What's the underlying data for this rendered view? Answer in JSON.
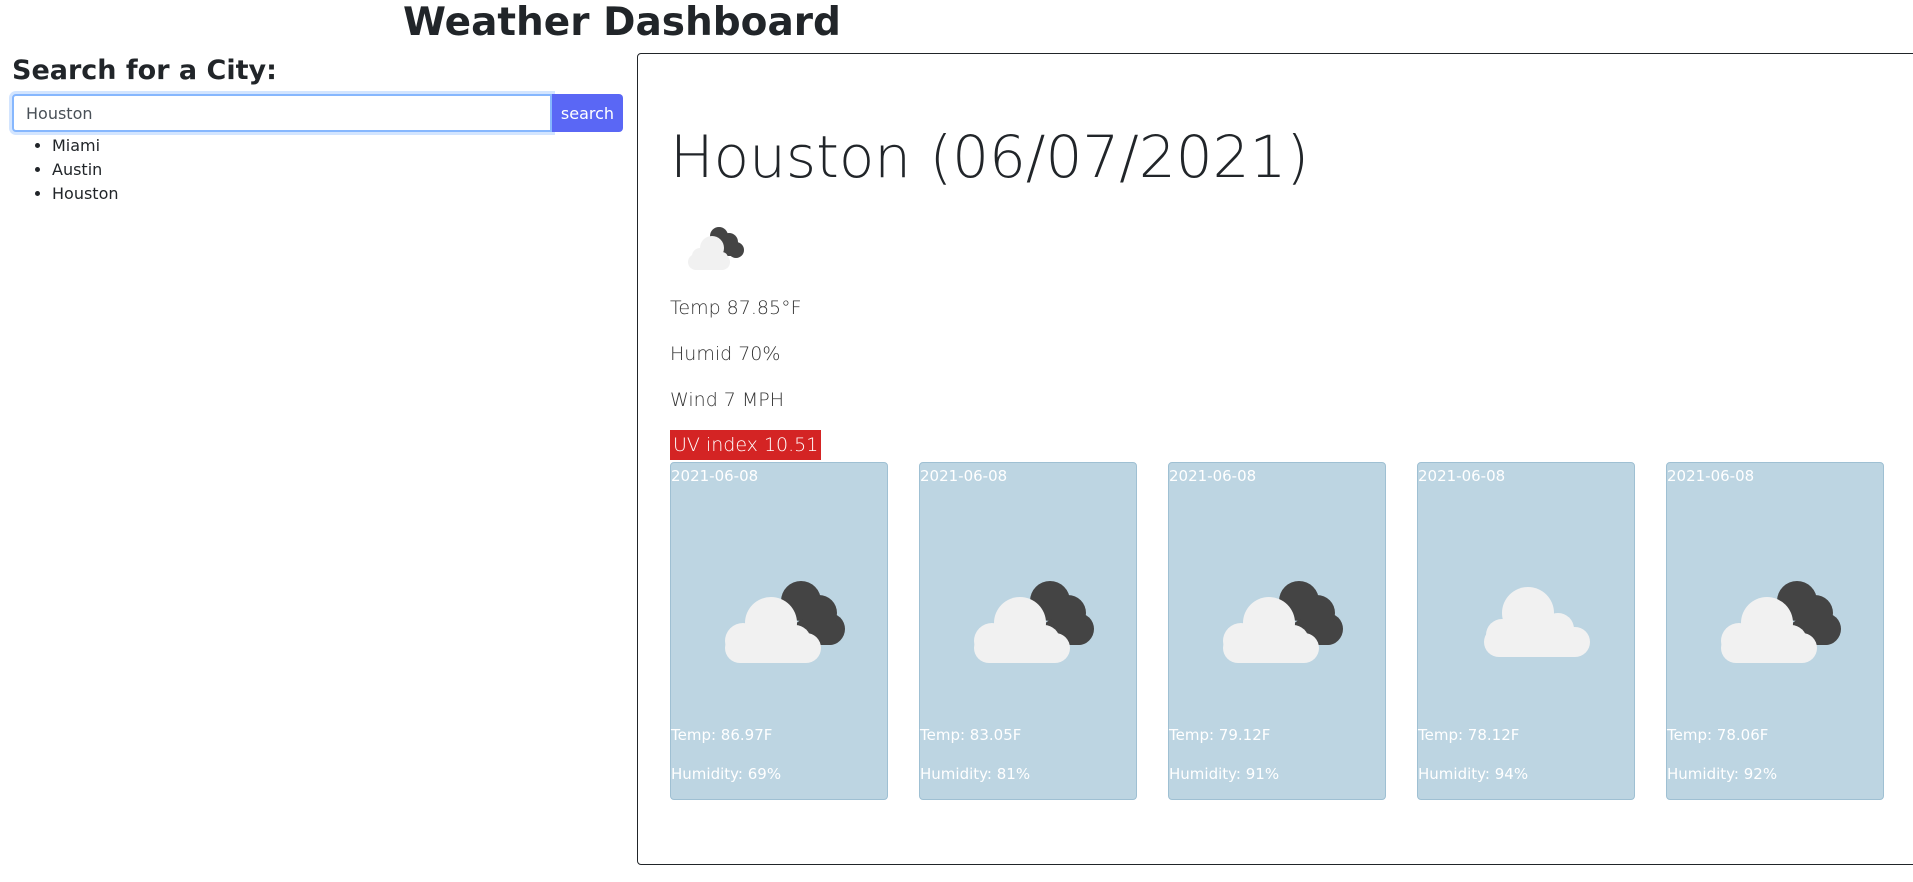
{
  "header": {
    "title": "Weather Dashboard"
  },
  "search": {
    "heading": "Search for a City:",
    "value": "Houston",
    "button_label": "search"
  },
  "history": [
    "Miami",
    "Austin",
    "Houston"
  ],
  "current": {
    "title": "Houston (06/07/2021)",
    "icon": "cloudy-icon",
    "temp": "Temp 87.85°F",
    "humid": "Humid 70%",
    "wind": "Wind 7 MPH",
    "uv": "UV index 10.51",
    "uv_color": "#d42424"
  },
  "forecast": [
    {
      "date": "2021-06-08",
      "icon": "broken-clouds-icon",
      "temp": "Temp: 86.97F",
      "humidity": "Humidity: 69%"
    },
    {
      "date": "2021-06-08",
      "icon": "broken-clouds-icon",
      "temp": "Temp: 83.05F",
      "humidity": "Humidity: 81%"
    },
    {
      "date": "2021-06-08",
      "icon": "broken-clouds-icon",
      "temp": "Temp: 79.12F",
      "humidity": "Humidity: 91%"
    },
    {
      "date": "2021-06-08",
      "icon": "scattered-clouds-icon",
      "temp": "Temp: 78.12F",
      "humidity": "Humidity: 94%"
    },
    {
      "date": "2021-06-08",
      "icon": "broken-clouds-icon",
      "temp": "Temp: 78.06F",
      "humidity": "Humidity: 92%"
    }
  ],
  "colors": {
    "accent": "#5a67f5",
    "card_bg": "#bdd5e2",
    "uv_high": "#d42424"
  }
}
